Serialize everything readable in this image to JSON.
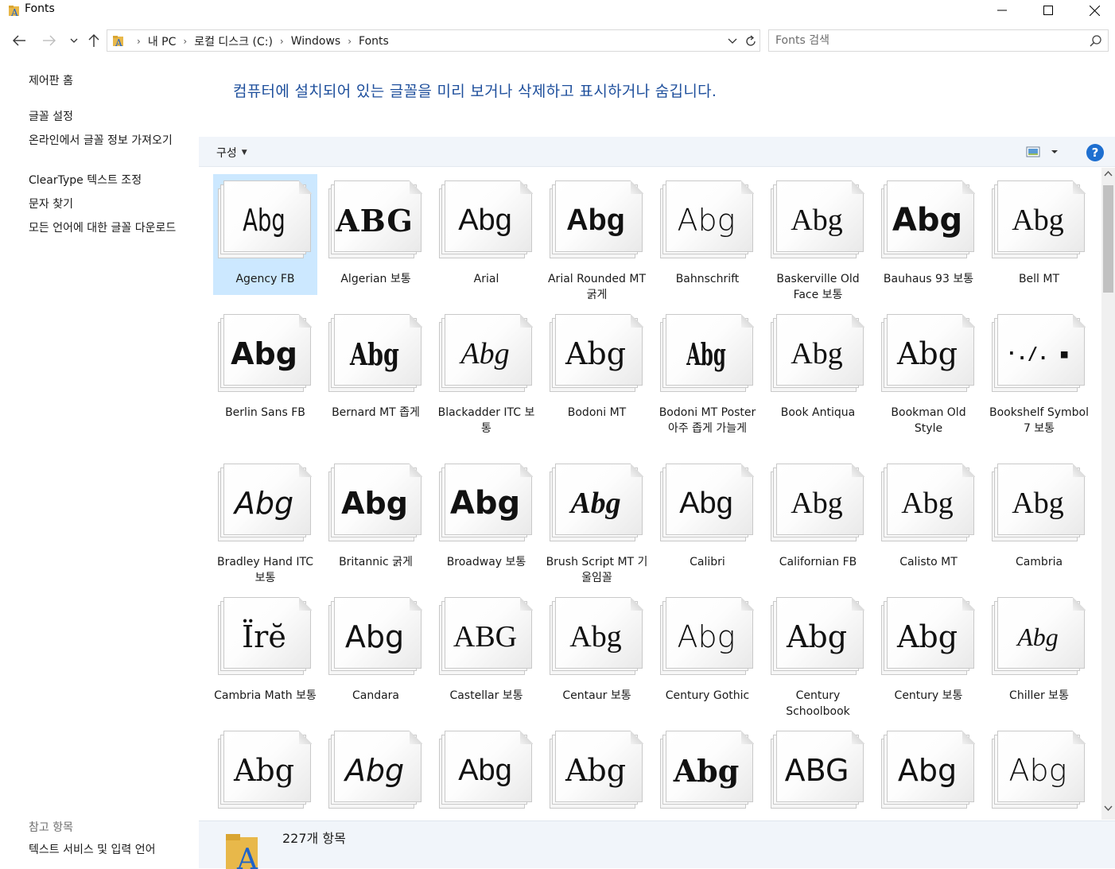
{
  "window": {
    "title": "Fonts"
  },
  "address": {
    "crumbs": [
      "내 PC",
      "로컬 디스크 (C:)",
      "Windows",
      "Fonts"
    ]
  },
  "search": {
    "placeholder": "Fonts 검색"
  },
  "left_pane": {
    "home": "제어판 홈",
    "links": [
      "글꼴 설정",
      "온라인에서 글꼴 정보 가져오기",
      "ClearType 텍스트 조정",
      "문자 찾기",
      "모든 언어에 대한 글꼴 다운로드"
    ],
    "see_also_title": "참고 항목",
    "see_also": [
      "텍스트 서비스 및 입력 언어"
    ]
  },
  "main": {
    "heading": "컴퓨터에 설치되어 있는 글꼴을 미리 보거나 삭제하고 표시하거나 숨깁니다.",
    "organize": "구성",
    "help": "?"
  },
  "fonts": [
    {
      "name": "Agency FB",
      "sample": "Abg",
      "selected": true
    },
    {
      "name": "Algerian 보통",
      "sample": "ABG"
    },
    {
      "name": "Arial",
      "sample": "Abg"
    },
    {
      "name": "Arial Rounded MT 굵게",
      "sample": "Abg"
    },
    {
      "name": "Bahnschrift",
      "sample": "Abg"
    },
    {
      "name": "Baskerville Old Face 보통",
      "sample": "Abg"
    },
    {
      "name": "Bauhaus 93 보통",
      "sample": "Abg"
    },
    {
      "name": "Bell MT",
      "sample": "Abg"
    },
    {
      "name": "Berlin Sans FB",
      "sample": "Abg"
    },
    {
      "name": "Bernard MT 좁게",
      "sample": "Abg"
    },
    {
      "name": "Blackadder ITC 보통",
      "sample": "Abg"
    },
    {
      "name": "Bodoni MT",
      "sample": "Abg"
    },
    {
      "name": "Bodoni MT Poster 아주 좁게 가늘게",
      "sample": "Abg"
    },
    {
      "name": "Book Antiqua",
      "sample": "Abg"
    },
    {
      "name": "Bookman Old Style",
      "sample": "Abg"
    },
    {
      "name": "Bookshelf Symbol 7 보통",
      "sample": "·.∕.   ▪"
    },
    {
      "name": "Bradley Hand ITC 보통",
      "sample": "Abg"
    },
    {
      "name": "Britannic 굵게",
      "sample": "Abg"
    },
    {
      "name": "Broadway 보통",
      "sample": "Abg"
    },
    {
      "name": "Brush Script MT 기울임꼴",
      "sample": "Abg"
    },
    {
      "name": "Calibri",
      "sample": "Abg"
    },
    {
      "name": "Californian FB",
      "sample": "Abg"
    },
    {
      "name": "Calisto MT",
      "sample": "Abg"
    },
    {
      "name": "Cambria",
      "sample": "Abg"
    },
    {
      "name": "Cambria Math 보통",
      "sample": "Ïrĕ"
    },
    {
      "name": "Candara",
      "sample": "Abg"
    },
    {
      "name": "Castellar 보통",
      "sample": "ABG"
    },
    {
      "name": "Centaur 보통",
      "sample": "Abg"
    },
    {
      "name": "Century Gothic",
      "sample": "Abg"
    },
    {
      "name": "Century Schoolbook",
      "sample": "Abg"
    },
    {
      "name": "Century 보통",
      "sample": "Abg"
    },
    {
      "name": "Chiller 보통",
      "sample": "Abg"
    },
    {
      "name": "",
      "sample": "Abg"
    },
    {
      "name": "",
      "sample": "Abg"
    },
    {
      "name": "",
      "sample": "Abg"
    },
    {
      "name": "",
      "sample": "Abg"
    },
    {
      "name": "",
      "sample": "Abg"
    },
    {
      "name": "",
      "sample": "ABG"
    },
    {
      "name": "",
      "sample": "Abg"
    },
    {
      "name": "",
      "sample": "Abg"
    }
  ],
  "status": {
    "count": "227개 항목"
  },
  "colors": {
    "accent": "#1e4f9c",
    "selection": "#cce8ff",
    "toolbar": "#f1f5fa"
  }
}
